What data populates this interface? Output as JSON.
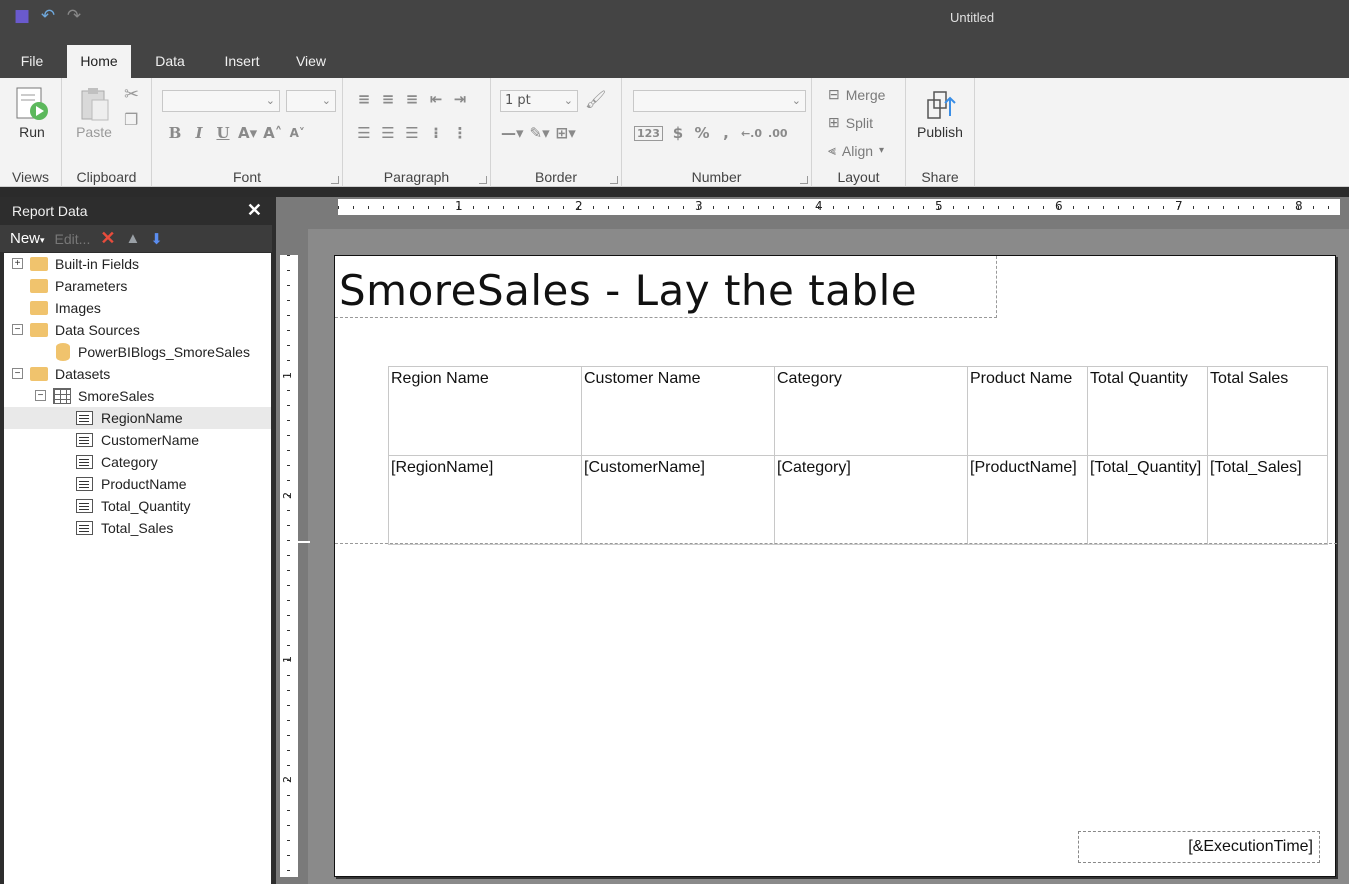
{
  "app": {
    "title": "Untitled"
  },
  "tabs": [
    {
      "label": "File"
    },
    {
      "label": "Home",
      "active": true
    },
    {
      "label": "Data"
    },
    {
      "label": "Insert"
    },
    {
      "label": "View"
    }
  ],
  "ribbon": {
    "views": {
      "label": "Views",
      "run": "Run"
    },
    "clipboard": {
      "label": "Clipboard",
      "paste": "Paste"
    },
    "font": {
      "label": "Font"
    },
    "paragraph": {
      "label": "Paragraph"
    },
    "border": {
      "label": "Border",
      "width_value": "1 pt"
    },
    "number": {
      "label": "Number"
    },
    "layout": {
      "label": "Layout",
      "merge": "Merge",
      "split": "Split",
      "align": "Align"
    },
    "share": {
      "label": "Share",
      "publish": "Publish"
    }
  },
  "report_data_panel": {
    "title": "Report Data",
    "toolbar": {
      "new": "New",
      "edit": "Edit..."
    },
    "tree": {
      "builtin_fields": "Built-in Fields",
      "parameters": "Parameters",
      "images": "Images",
      "data_sources": "Data Sources",
      "data_source_item": "PowerBIBlogs_SmoreSales",
      "datasets": "Datasets",
      "dataset": "SmoreSales",
      "fields": [
        "RegionName",
        "CustomerName",
        "Category",
        "ProductName",
        "Total_Quantity",
        "Total_Sales"
      ]
    }
  },
  "rulers": {
    "top_numbers": [
      "1",
      "2",
      "3",
      "4",
      "5",
      "6",
      "7",
      "8"
    ],
    "left_numbers": [
      "1",
      "2",
      "1",
      "2"
    ]
  },
  "report": {
    "title": "SmoreSales - Lay the table",
    "table": {
      "headers": [
        "Region Name",
        "Customer Name",
        "Category",
        "Product Name",
        "Total Quantity",
        "Total Sales"
      ],
      "details": [
        "[RegionName]",
        "[CustomerName]",
        "[Category]",
        "[ProductName]",
        "[Total_Quantity]",
        "[Total_Sales]"
      ]
    },
    "footer_expression": "[&ExecutionTime]"
  }
}
